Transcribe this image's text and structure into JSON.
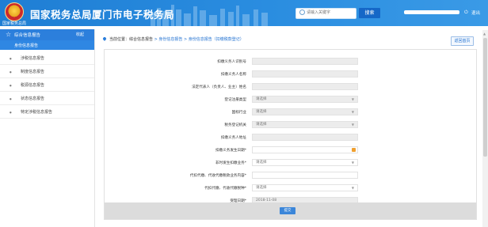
{
  "header": {
    "emblem_caption": "国家税务总局",
    "title": "国家税务总局厦门市电子税务局",
    "search_placeholder": "请输入关键字",
    "search_button": "搜索",
    "logout_label": "退出",
    "colors": {
      "bar": "#1f7ed4",
      "search_button": "#1567c7"
    }
  },
  "sidebar": {
    "head_label": "综合信息报告",
    "collapse_label": "收起",
    "active_item": "身份信息报告",
    "items": [
      "涉税信息报告",
      "制度信息报告",
      "税源信息报告",
      "状态信息报告",
      "特定涉税信息报告"
    ],
    "colors": {
      "head": "#2c7fdc",
      "active": "#2f87e3"
    }
  },
  "breadcrumb": {
    "prefix": "当前位置：",
    "parts": [
      "综合信息报告",
      "身份信息报告",
      "身份信息报告（扣缴税款登记）"
    ],
    "separator": " > "
  },
  "back_button": "返回首页",
  "form": {
    "fields": [
      {
        "label": "扣缴义务人识别号",
        "value": "",
        "kind": "text"
      },
      {
        "label": "扣缴义务人名称",
        "value": "",
        "kind": "text"
      },
      {
        "label": "法定代表人（负责人、业主）姓名",
        "value": "",
        "kind": "text"
      },
      {
        "label": "登记注册类型",
        "value": "请选择",
        "kind": "select"
      },
      {
        "label": "国标行业",
        "value": "请选择",
        "kind": "select"
      },
      {
        "label": "税务登记机关",
        "value": "请选择",
        "kind": "select"
      },
      {
        "label": "扣缴义务人地址",
        "value": "",
        "kind": "text"
      },
      {
        "label": "扣缴义务发生日期*",
        "value": "",
        "kind": "date"
      },
      {
        "label": "非时发生扣缴业务*",
        "value": "请选择",
        "kind": "select-white"
      },
      {
        "label": "代扣代缴、代收代缴税款业务内容*",
        "value": "",
        "kind": "text-white"
      },
      {
        "label": "代扣代缴、代收代缴税种*",
        "value": "请选择",
        "kind": "select-white"
      },
      {
        "label": "受理日期*",
        "value": "2018-11-08",
        "kind": "text"
      }
    ],
    "submit_label": "提交",
    "colors": {
      "submit": "#3b86d9",
      "footer": "#dcdcdc"
    }
  },
  "icons": {
    "sidebar_head": "star-icon",
    "caret": "chevron-down-icon",
    "date": "calendar-icon",
    "search": "search-icon",
    "location": "location-pin-icon"
  }
}
